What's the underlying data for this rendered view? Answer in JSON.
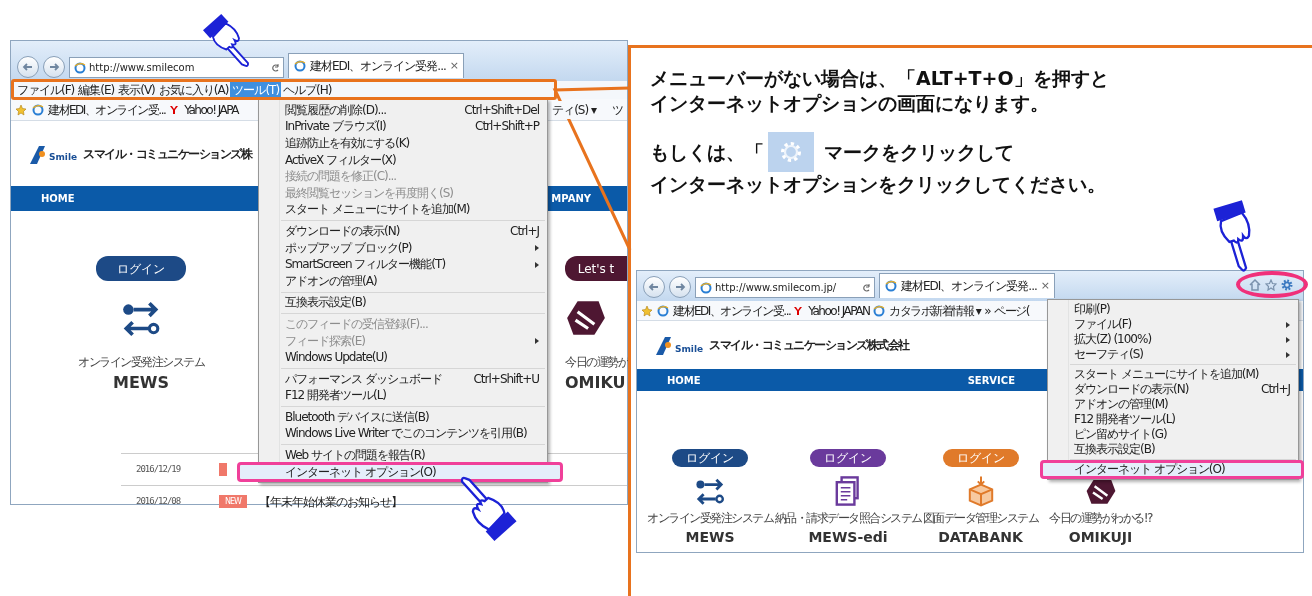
{
  "left_window": {
    "address": "http://www.smilecom",
    "tab_title": "建材EDI、オンライン受発...",
    "tab_close": "×",
    "menu_bar": [
      {
        "label": "ファイル(F)",
        "selected": false
      },
      {
        "label": "編集(E)",
        "selected": false
      },
      {
        "label": "表示(V)",
        "selected": false
      },
      {
        "label": "お気に入り(A)",
        "selected": false
      },
      {
        "label": "ツール(T)",
        "selected": true
      },
      {
        "label": "ヘルプ(H)",
        "selected": false
      }
    ],
    "favorites": [
      "建材EDI、オンライン受...",
      "Yahoo! JAPA"
    ],
    "command_bar": [
      "ティ(S) ▾",
      "ツ"
    ],
    "logo_text": "Smile",
    "company_name": "スマイル・コミュニケーションズ株",
    "nav": [
      "HOME",
      "MPANY"
    ],
    "services": [
      {
        "kind": "arrows",
        "button": "ログイン",
        "color": "#1d4a86",
        "caption": "オンライン受発注システム",
        "name": "MEWS"
      },
      {
        "kind": "omikuji",
        "button": "Let's t",
        "color": "#4e1732",
        "caption": "今日の運勢が",
        "name": "OMIKU"
      }
    ],
    "news": [
      {
        "date": "2016/12/19"
      },
      {
        "date": "2016/12/08",
        "badge": "NEW",
        "title": "【年末年始休業のお知らせ】"
      }
    ],
    "tools_menu": [
      {
        "items": [
          {
            "label": "閲覧履歴の削除(D)...",
            "shortcut": "Ctrl+Shift+Del",
            "disabled": false,
            "submenu": false,
            "selected": false
          },
          {
            "label": "InPrivate ブラウズ(I)",
            "shortcut": "Ctrl+Shift+P",
            "disabled": false,
            "submenu": false,
            "selected": false
          },
          {
            "label": "追跡防止を有効にする(K)",
            "disabled": false,
            "submenu": false,
            "selected": false
          },
          {
            "label": "ActiveX フィルター(X)",
            "disabled": false,
            "submenu": false,
            "selected": false
          },
          {
            "label": "接続の問題を修正(C)...",
            "disabled": true,
            "submenu": false,
            "selected": false
          },
          {
            "label": "最終閲覧セッションを再度開く(S)",
            "disabled": true,
            "submenu": false,
            "selected": false
          },
          {
            "label": "スタート メニューにサイトを追加(M)",
            "disabled": false,
            "submenu": false,
            "selected": false
          }
        ]
      },
      {
        "items": [
          {
            "label": "ダウンロードの表示(N)",
            "shortcut": "Ctrl+J",
            "disabled": false,
            "submenu": false,
            "selected": false
          },
          {
            "label": "ポップアップ ブロック(P)",
            "disabled": false,
            "submenu": true,
            "selected": false
          },
          {
            "label": "SmartScreen フィルター機能(T)",
            "disabled": false,
            "submenu": true,
            "selected": false
          },
          {
            "label": "アドオンの管理(A)",
            "disabled": false,
            "submenu": false,
            "selected": false
          }
        ]
      },
      {
        "items": [
          {
            "label": "互換表示設定(B)",
            "disabled": false,
            "submenu": false,
            "selected": false
          }
        ]
      },
      {
        "items": [
          {
            "label": "このフィードの受信登録(F)...",
            "disabled": true,
            "submenu": false,
            "selected": false
          },
          {
            "label": "フィード探索(E)",
            "disabled": true,
            "submenu": true,
            "selected": false
          },
          {
            "label": "Windows Update(U)",
            "disabled": false,
            "submenu": false,
            "selected": false
          }
        ]
      },
      {
        "items": [
          {
            "label": "パフォーマンス ダッシュボード",
            "shortcut": "Ctrl+Shift+U",
            "disabled": false,
            "submenu": false,
            "selected": false
          },
          {
            "label": "F12 開発者ツール(L)",
            "disabled": false,
            "submenu": false,
            "selected": false
          }
        ]
      },
      {
        "items": [
          {
            "label": "Bluetooth デバイスに送信(B)",
            "disabled": false,
            "submenu": false,
            "selected": false
          },
          {
            "label": "Windows Live Writer でこのコンテンツを引用(B)",
            "disabled": false,
            "submenu": false,
            "selected": false
          }
        ]
      },
      {
        "items": [
          {
            "label": "Web サイトの問題を報告(R)",
            "disabled": false,
            "submenu": false,
            "selected": false
          },
          {
            "label": "インターネット オプション(O)",
            "disabled": false,
            "submenu": false,
            "selected": true
          }
        ]
      }
    ]
  },
  "callout": {
    "line_1": "メニューバーがない場合は、「ALT+T+O」を押すと",
    "line_2": "インターネットオプションの画面になります。",
    "line_3_before": "もしくは、「",
    "line_3_after": "マークをクリックして",
    "line_4": "インターネットオプションをクリックしてください。"
  },
  "right_window": {
    "address": "http://www.smilecom.jp/",
    "tab_title": "建材EDI、オンライン受発...",
    "tab_close": "×",
    "favorites": [
      "建材EDI、オンライン受...",
      "Yahoo! JAPAN",
      "カタラボ新着情報 ▾"
    ],
    "command_bar": [
      "»",
      "ページ("
    ],
    "logo_text": "Smile",
    "company_name": "スマイル・コミュニケーションズ株式会社",
    "nav": [
      "HOME",
      "SERVICE"
    ],
    "services": [
      {
        "kind": "arrows",
        "button": "ログイン",
        "color": "#1d4a86",
        "caption": "オンライン受発注システム",
        "name": "MEWS"
      },
      {
        "kind": "documents",
        "button": "ログイン",
        "color": "#6a3a9c",
        "caption": "納品・請求データ照合システム",
        "name": "MEWS-edi"
      },
      {
        "kind": "box",
        "button": "ログイン",
        "color": "#e07a2a",
        "caption": "図面データ管理システム",
        "name": "DATABANK"
      },
      {
        "kind": "omikuji",
        "color": "#4e1732",
        "caption": "今日の運勢がわかる!?",
        "name": "OMIKUJI"
      }
    ],
    "tools_menu": [
      {
        "items": [
          {
            "label": "印刷(P)",
            "disabled": false,
            "submenu": false,
            "selected": false
          },
          {
            "label": "ファイル(F)",
            "disabled": false,
            "submenu": true,
            "selected": false
          },
          {
            "label": "拡大(Z) (100%)",
            "disabled": false,
            "submenu": true,
            "selected": false
          },
          {
            "label": "セーフティ(S)",
            "disabled": false,
            "submenu": true,
            "selected": false
          }
        ]
      },
      {
        "items": [
          {
            "label": "スタート メニューにサイトを追加(M)",
            "disabled": false,
            "submenu": false,
            "selected": false
          },
          {
            "label": "ダウンロードの表示(N)",
            "shortcut": "Ctrl+J",
            "disabled": false,
            "submenu": false,
            "selected": false
          },
          {
            "label": "アドオンの管理(M)",
            "disabled": false,
            "submenu": false,
            "selected": false
          },
          {
            "label": "F12 開発者ツール(L)",
            "disabled": false,
            "submenu": false,
            "selected": false
          },
          {
            "label": "ピン留めサイト(G)",
            "disabled": false,
            "submenu": false,
            "selected": false
          },
          {
            "label": "互換表示設定(B)",
            "disabled": false,
            "submenu": false,
            "selected": false
          }
        ]
      },
      {
        "items": [
          {
            "label": "インターネット オプション(O)",
            "disabled": false,
            "submenu": false,
            "selected": true
          }
        ]
      }
    ]
  }
}
